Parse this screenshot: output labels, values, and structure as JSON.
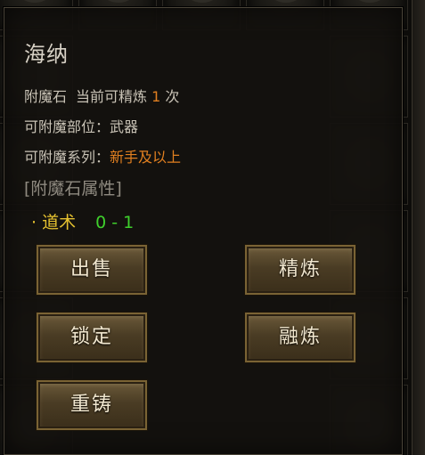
{
  "item": {
    "name": "海纳",
    "type_label": "附魔石",
    "refine_prefix": "当前可精炼",
    "refine_count": "1",
    "refine_suffix": "次",
    "slot_label": "可附魔部位：",
    "slot_value": "武器",
    "series_label": "可附魔系列：",
    "series_value": "新手及以上"
  },
  "attributes": {
    "header": "[附魔石属性]",
    "bullet": "·",
    "rows": [
      {
        "name": "道术",
        "value": "0 - 1"
      }
    ]
  },
  "buttons": {
    "sell": "出售",
    "refine": "精炼",
    "lock": "锁定",
    "fuse": "融炼",
    "recast": "重铸"
  },
  "colors": {
    "highlight_orange": "#e07f20",
    "attr_name_yellow": "#e6c230",
    "attr_value_green": "#3fd02c"
  }
}
